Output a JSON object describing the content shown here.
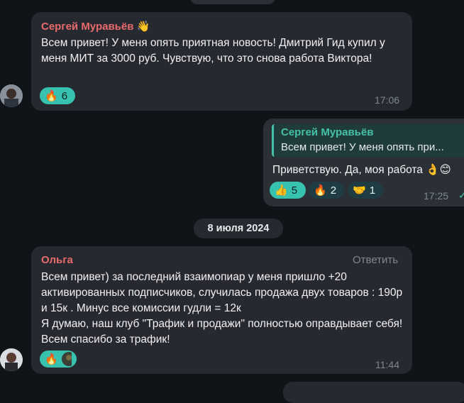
{
  "messages": [
    {
      "sender": "Сергей Муравьёв",
      "sender_emoji": "👋",
      "text": "Всем привет! У меня опять приятная новость! Дмитрий Гид купил у меня МИТ за 3000 руб. Чувствую, что это снова работа Виктора!",
      "reactions": [
        {
          "emoji": "🔥",
          "count": "6"
        }
      ],
      "time": "17:06",
      "name_color": "#e86a6a"
    },
    {
      "quote_author": "Сергей Муравьёв",
      "quote_text": "Всем привет! У меня опять при...",
      "text": "Приветствую. Да, моя работа 👌😊",
      "reactions": [
        {
          "emoji": "👍",
          "count": "5"
        },
        {
          "emoji": "🔥",
          "count": "2"
        },
        {
          "emoji": "🤝",
          "count": "1"
        }
      ],
      "time": "17:25",
      "read_mark": "✓",
      "quote_color": "#45c0a9"
    },
    {
      "sender": "Ольга",
      "reply_label": "Ответить",
      "text": "Всем привет) за последний взаимопиар у меня пришло +20 активированных подписчиков, случилась продажа двух товаров : 190р и 15к . Минус все комиссии гудли = 12к\nЯ думаю, наш клуб \"Трафик и продажи\" полностью оправдывает себя! Всем спасибо за трафик!",
      "reactions": [
        {
          "emoji": "🔥",
          "count": ""
        }
      ],
      "time": "11:44",
      "name_color": "#e86a6a"
    }
  ],
  "date_separator": "8 июля 2024"
}
